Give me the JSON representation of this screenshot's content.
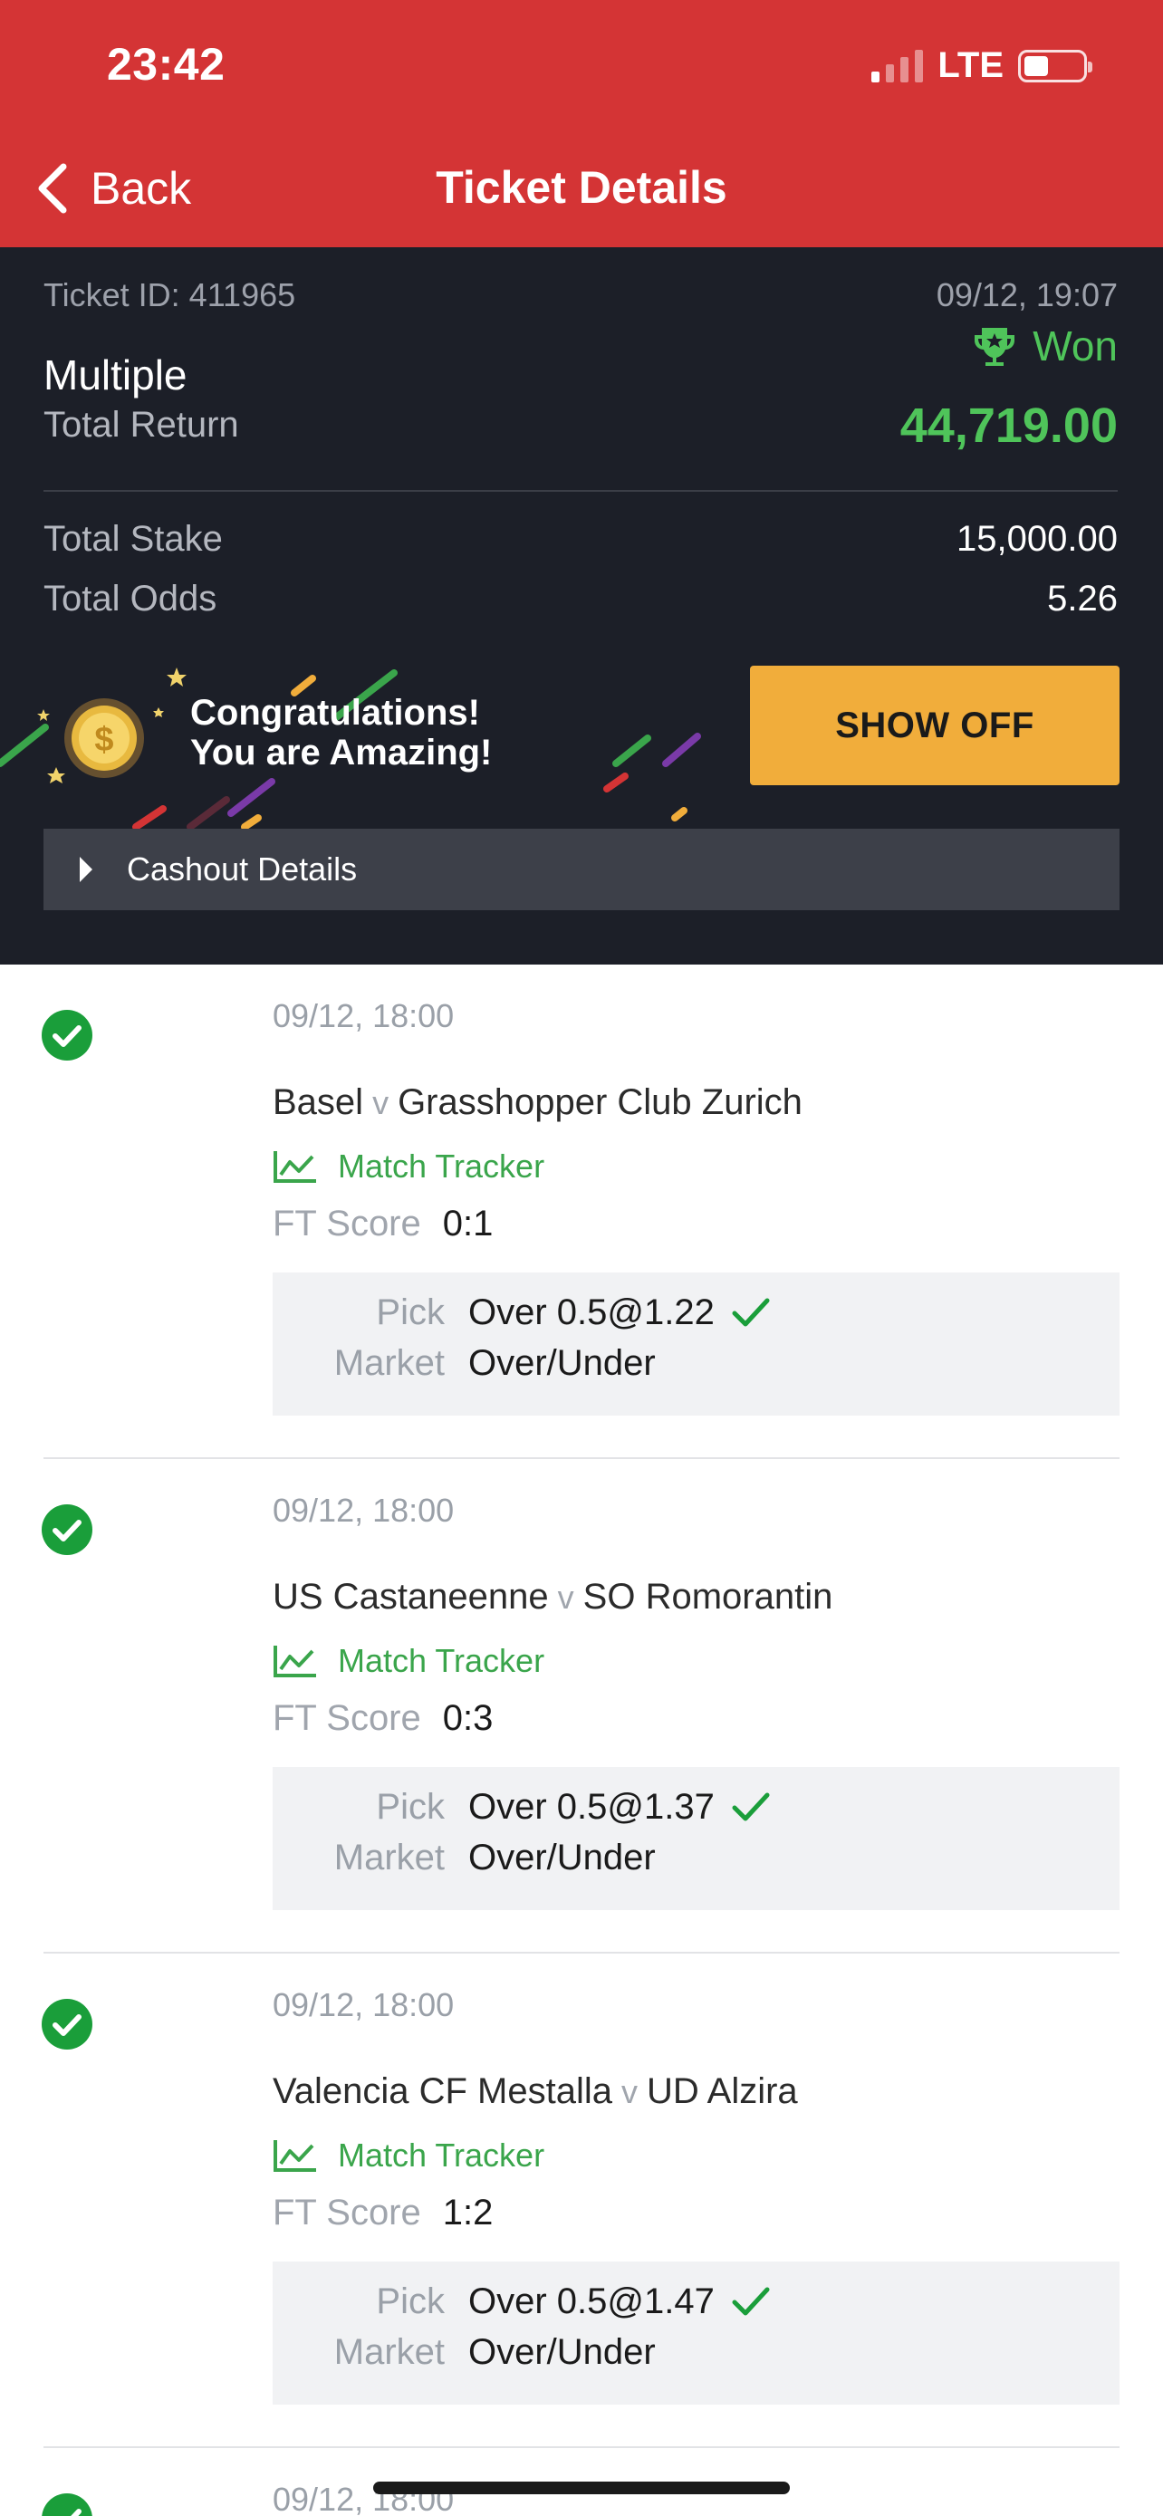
{
  "status_bar": {
    "time": "23:42",
    "network": "LTE"
  },
  "nav": {
    "back_label": "Back",
    "title": "Ticket Details"
  },
  "ticket": {
    "id_label": "Ticket ID: 411965",
    "datetime": "09/12, 19:07",
    "status": "Won",
    "bet_type": "Multiple",
    "total_return_label": "Total Return",
    "total_return": "44,719.00",
    "total_stake_label": "Total Stake",
    "total_stake": "15,000.00",
    "total_odds_label": "Total Odds",
    "total_odds": "5.26"
  },
  "banner": {
    "line1": "Congratulations!",
    "line2": "You are Amazing!",
    "button_label": "SHOW OFF"
  },
  "cashout": {
    "label": "Cashout Details"
  },
  "labels": {
    "versus": "v",
    "match_tracker": "Match Tracker",
    "ft_score": "FT Score",
    "pick": "Pick",
    "market": "Market"
  },
  "selections": [
    {
      "date": "09/12, 18:00",
      "home": "Basel",
      "away": "Grasshopper Club Zurich",
      "score": "0:1",
      "pick": "Over 0.5@1.22",
      "market": "Over/Under"
    },
    {
      "date": "09/12, 18:00",
      "home": "US Castaneenne",
      "away": "SO Romorantin",
      "score": "0:3",
      "pick": "Over 0.5@1.37",
      "market": "Over/Under"
    },
    {
      "date": "09/12, 18:00",
      "home": "Valencia CF Mestalla",
      "away": "UD Alzira",
      "score": "1:2",
      "pick": "Over 0.5@1.47",
      "market": "Over/Under"
    },
    {
      "date": "09/12, 18:00"
    }
  ],
  "colors": {
    "header_red": "#d43435",
    "summary_dark": "#1c1f28",
    "won_green": "#4fc45a",
    "button_gold": "#f1ad3b"
  }
}
